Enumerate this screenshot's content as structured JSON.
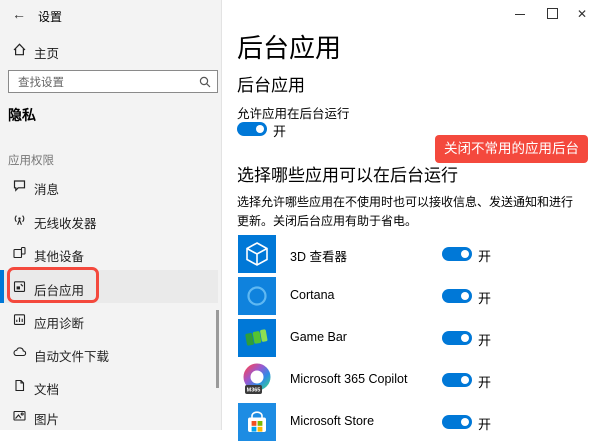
{
  "titlebar": {
    "back_icon": "←",
    "title": "设置",
    "close_icon": "✕"
  },
  "sidebar": {
    "home_label": "主页",
    "search_placeholder": "查找设置",
    "section_title": "隐私",
    "group_label": "应用权限",
    "items": [
      {
        "label": "消息",
        "icon": "message-icon",
        "selected": false
      },
      {
        "label": "无线收发器",
        "icon": "radios-icon",
        "selected": false
      },
      {
        "label": "其他设备",
        "icon": "other-devices-icon",
        "selected": false
      },
      {
        "label": "后台应用",
        "icon": "background-apps-icon",
        "selected": true,
        "annotated": true
      },
      {
        "label": "应用诊断",
        "icon": "app-diagnostics-icon",
        "selected": false
      },
      {
        "label": "自动文件下载",
        "icon": "cloud-download-icon",
        "selected": false
      },
      {
        "label": "文档",
        "icon": "document-icon",
        "selected": false
      },
      {
        "label": "图片",
        "icon": "picture-icon",
        "selected": false
      }
    ]
  },
  "main": {
    "page_title": "后台应用",
    "background_section": {
      "heading": "后台应用",
      "permission_label": "允许应用在后台运行",
      "toggle_state": "开"
    },
    "annotation": {
      "label": "关闭不常用的应用后台"
    },
    "choose_section": {
      "heading": "选择哪些应用可以在后台运行",
      "description": "选择允许哪些应用在不使用时也可以接收信息、发送通知和进行更新。关闭后台应用有助于省电。"
    },
    "apps": [
      {
        "name": "3D 查看器",
        "state": "开",
        "icon": "3d-viewer-icon"
      },
      {
        "name": "Cortana",
        "state": "开",
        "icon": "cortana-icon"
      },
      {
        "name": "Game Bar",
        "state": "开",
        "icon": "game-bar-icon"
      },
      {
        "name": "Microsoft 365 Copilot",
        "state": "开",
        "icon": "m365-copilot-icon",
        "badge": "M365"
      },
      {
        "name": "Microsoft Store",
        "state": "开",
        "icon": "microsoft-store-icon"
      }
    ]
  },
  "colors": {
    "accent": "#0078d7",
    "annotation_red": "#f4493d"
  }
}
